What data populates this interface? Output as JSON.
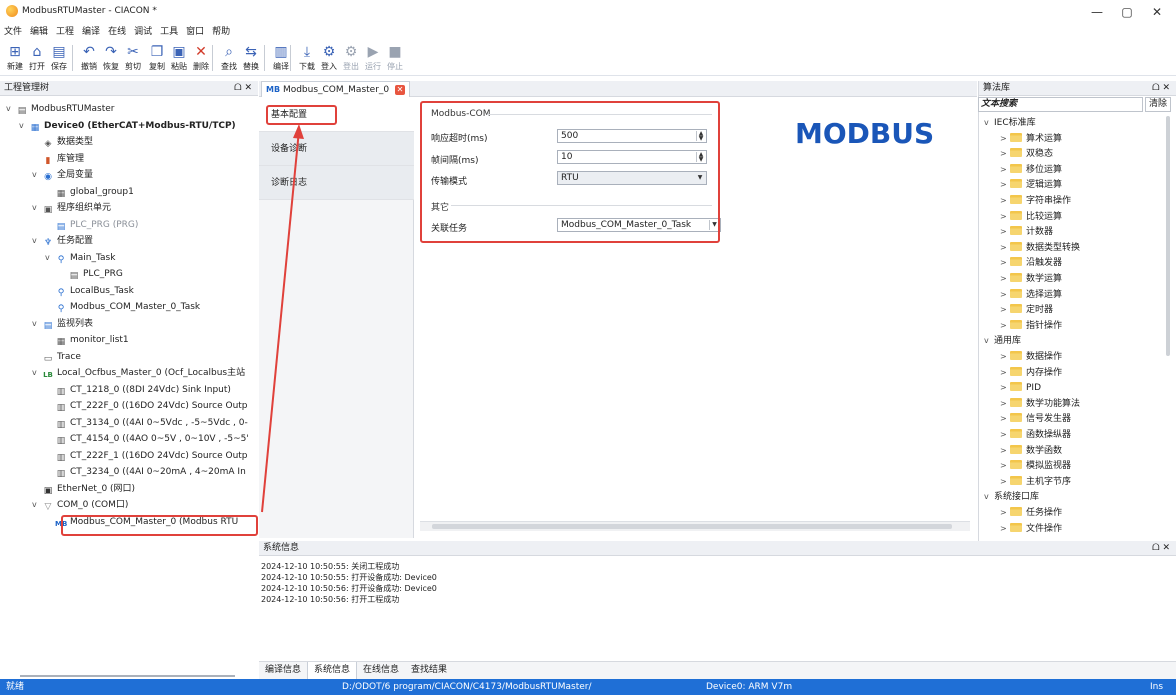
{
  "window": {
    "title": "ModbusRTUMaster - CIACON *",
    "minimize": "—",
    "maximize": "▢",
    "close": "✕"
  },
  "menu": [
    "文件",
    "编辑",
    "工程",
    "编译",
    "在线",
    "调试",
    "工具",
    "窗口",
    "帮助"
  ],
  "toolbar": [
    {
      "label": "新建",
      "icon": "new-icon",
      "glyph": "⊞",
      "enabled": true
    },
    {
      "label": "打开",
      "icon": "open-icon",
      "glyph": "⌂",
      "enabled": true
    },
    {
      "label": "保存",
      "icon": "save-icon",
      "glyph": "▤",
      "enabled": true
    },
    {
      "label": "撤销",
      "icon": "undo-icon",
      "glyph": "↶",
      "enabled": true
    },
    {
      "label": "恢复",
      "icon": "redo-icon",
      "glyph": "↷",
      "enabled": true
    },
    {
      "label": "剪切",
      "icon": "cut-icon",
      "glyph": "✂",
      "enabled": true
    },
    {
      "label": "复制",
      "icon": "copy-icon",
      "glyph": "❐",
      "enabled": true
    },
    {
      "label": "粘贴",
      "icon": "paste-icon",
      "glyph": "▣",
      "enabled": true
    },
    {
      "label": "删除",
      "icon": "delete-icon",
      "glyph": "✕",
      "enabled": true
    },
    {
      "label": "查找",
      "icon": "find-icon",
      "glyph": "⌕",
      "enabled": true
    },
    {
      "label": "替换",
      "icon": "replace-icon",
      "glyph": "⇆",
      "enabled": true
    },
    {
      "label": "编译",
      "icon": "compile-icon",
      "glyph": "▥",
      "enabled": true
    },
    {
      "label": "下载",
      "icon": "download-icon",
      "glyph": "⤓",
      "enabled": true
    },
    {
      "label": "登入",
      "icon": "login-icon",
      "glyph": "⚙",
      "enabled": true
    },
    {
      "label": "登出",
      "icon": "logout-icon",
      "glyph": "⚙",
      "enabled": false
    },
    {
      "label": "运行",
      "icon": "run-icon",
      "glyph": "▶",
      "enabled": false
    },
    {
      "label": "停止",
      "icon": "stop-icon",
      "glyph": "■",
      "enabled": false
    }
  ],
  "project_tree": {
    "title": "工程管理树",
    "pin": "ᗝ ✕",
    "items": [
      {
        "label": "ModbusRTUMaster",
        "level": 0,
        "arrow": "v",
        "icon": "project-icon",
        "glyph": "▤",
        "color": "#555"
      },
      {
        "label": "Device0 (EtherCAT+Modbus-RTU/TCP)",
        "level": 1,
        "arrow": "v",
        "icon": "device-icon",
        "glyph": "▦",
        "color": "#2a6fd0",
        "bold": true
      },
      {
        "label": "数据类型",
        "level": 2,
        "arrow": "",
        "icon": "datatype-icon",
        "glyph": "◈",
        "color": "#555"
      },
      {
        "label": "库管理",
        "level": 2,
        "arrow": "",
        "icon": "library-icon",
        "glyph": "▮",
        "color": "#d0562a"
      },
      {
        "label": "全局变量",
        "level": 2,
        "arrow": "v",
        "icon": "globe-icon",
        "glyph": "◉",
        "color": "#2a6fd0"
      },
      {
        "label": "global_group1",
        "level": 3,
        "arrow": "",
        "icon": "table-icon",
        "glyph": "▦",
        "color": "#555"
      },
      {
        "label": "程序组织单元",
        "level": 2,
        "arrow": "v",
        "icon": "pou-icon",
        "glyph": "▣",
        "color": "#555"
      },
      {
        "label": "PLC_PRG (PRG)",
        "level": 3,
        "arrow": "",
        "icon": "program-icon",
        "glyph": "▤",
        "color": "#2a6fd0",
        "grey": true
      },
      {
        "label": "任务配置",
        "level": 2,
        "arrow": "v",
        "icon": "task-config-icon",
        "glyph": "♆",
        "color": "#2a6fd0"
      },
      {
        "label": "Main_Task",
        "level": 3,
        "arrow": "v",
        "icon": "task-icon",
        "glyph": "⚲",
        "color": "#2a6fd0"
      },
      {
        "label": "PLC_PRG",
        "level": 4,
        "arrow": "",
        "icon": "program-icon",
        "glyph": "▤",
        "color": "#555"
      },
      {
        "label": "LocalBus_Task",
        "level": 3,
        "arrow": "",
        "icon": "task-icon",
        "glyph": "⚲",
        "color": "#2a6fd0"
      },
      {
        "label": "Modbus_COM_Master_0_Task",
        "level": 3,
        "arrow": "",
        "icon": "task-icon",
        "glyph": "⚲",
        "color": "#2a6fd0"
      },
      {
        "label": "监视列表",
        "level": 2,
        "arrow": "v",
        "icon": "watch-icon",
        "glyph": "▤",
        "color": "#2a6fd0"
      },
      {
        "label": "monitor_list1",
        "level": 3,
        "arrow": "",
        "icon": "table-icon",
        "glyph": "▦",
        "color": "#555"
      },
      {
        "label": "Trace",
        "level": 2,
        "arrow": "",
        "icon": "trace-icon",
        "glyph": "▭",
        "color": "#555"
      },
      {
        "label": "Local_Ocfbus_Master_0 (Ocf_Localbus主站",
        "level": 2,
        "arrow": "v",
        "icon": "localbus-icon",
        "glyph": "LB",
        "color": "#2a8a3a"
      },
      {
        "label": "CT_1218_0 ((8DI 24Vdc) Sink Input)",
        "level": 3,
        "arrow": "",
        "icon": "module-icon",
        "glyph": "▥",
        "color": "#555"
      },
      {
        "label": "CT_222F_0 ((16DO 24Vdc) Source Outp",
        "level": 3,
        "arrow": "",
        "icon": "module-icon",
        "glyph": "▥",
        "color": "#555"
      },
      {
        "label": "CT_3134_0 ((4AI 0~5Vdc , -5~5Vdc , 0-",
        "level": 3,
        "arrow": "",
        "icon": "module-icon",
        "glyph": "▥",
        "color": "#555"
      },
      {
        "label": "CT_4154_0 ((4AO 0~5V , 0~10V , -5~5'",
        "level": 3,
        "arrow": "",
        "icon": "module-icon",
        "glyph": "▥",
        "color": "#555"
      },
      {
        "label": "CT_222F_1 ((16DO 24Vdc) Source Outp",
        "level": 3,
        "arrow": "",
        "icon": "module-icon",
        "glyph": "▥",
        "color": "#555"
      },
      {
        "label": "CT_3234_0 ((4AI 0~20mA , 4~20mA In",
        "level": 3,
        "arrow": "",
        "icon": "module-icon",
        "glyph": "▥",
        "color": "#555"
      },
      {
        "label": "EtherNet_0 (网口)",
        "level": 2,
        "arrow": "",
        "icon": "ethernet-icon",
        "glyph": "▣",
        "color": "#333"
      },
      {
        "label": "COM_0 (COM口)",
        "level": 2,
        "arrow": "v",
        "icon": "com-icon",
        "glyph": "▽",
        "color": "#888"
      },
      {
        "label": "Modbus_COM_Master_0 (Modbus RTU",
        "level": 3,
        "arrow": "",
        "icon": "modbus-icon",
        "glyph": "MB",
        "color": "#1c63c7",
        "selected": true
      }
    ]
  },
  "editor_tab": {
    "icon_text": "MB",
    "label": "Modbus_COM_Master_0",
    "close": "✕"
  },
  "side_tabs": [
    "基本配置",
    "设备诊断",
    "诊断日志"
  ],
  "config": {
    "group1_title": "Modbus-COM",
    "response_timeout_label": "响应超时(ms)",
    "response_timeout_value": "500",
    "frame_interval_label": "帧间隔(ms)",
    "frame_interval_value": "10",
    "transfer_mode_label": "传输模式",
    "transfer_mode_value": "RTU",
    "group2_title": "其它",
    "assoc_task_label": "关联任务",
    "assoc_task_value": "Modbus_COM_Master_0_Task"
  },
  "logo_text": "MODBUS",
  "system_info": {
    "title": "系统信息",
    "pin": "ᗝ ✕",
    "lines": [
      "2024-12-10 10:50:55: 关闭工程成功",
      "2024-12-10 10:50:55: 打开设备成功: Device0",
      "2024-12-10 10:50:56: 打开设备成功: Device0",
      "2024-12-10 10:50:56: 打开工程成功"
    ]
  },
  "bottom_tabs": [
    "编译信息",
    "系统信息",
    "在线信息",
    "查找结果"
  ],
  "library": {
    "title": "算法库",
    "pin": "ᗝ ✕",
    "search_placeholder": "文本搜索",
    "clear_label": "清除",
    "items": [
      {
        "label": "IEC标准库",
        "group": true,
        "arrow": "v"
      },
      {
        "label": "算术运算",
        "arrow": ">"
      },
      {
        "label": "双稳态",
        "arrow": ">"
      },
      {
        "label": "移位运算",
        "arrow": ">"
      },
      {
        "label": "逻辑运算",
        "arrow": ">"
      },
      {
        "label": "字符串操作",
        "arrow": ">"
      },
      {
        "label": "比较运算",
        "arrow": ">"
      },
      {
        "label": "计数器",
        "arrow": ">"
      },
      {
        "label": "数据类型转换",
        "arrow": ">"
      },
      {
        "label": "沿触发器",
        "arrow": ">"
      },
      {
        "label": "数学运算",
        "arrow": ">"
      },
      {
        "label": "选择运算",
        "arrow": ">"
      },
      {
        "label": "定时器",
        "arrow": ">"
      },
      {
        "label": "指针操作",
        "arrow": ">"
      },
      {
        "label": "通用库",
        "group": true,
        "arrow": "v"
      },
      {
        "label": "数据操作",
        "arrow": ">"
      },
      {
        "label": "内存操作",
        "arrow": ">"
      },
      {
        "label": "PID",
        "arrow": ">"
      },
      {
        "label": "数学功能算法",
        "arrow": ">"
      },
      {
        "label": "信号发生器",
        "arrow": ">"
      },
      {
        "label": "函数操纵器",
        "arrow": ">"
      },
      {
        "label": "数学函数",
        "arrow": ">"
      },
      {
        "label": "模拟监视器",
        "arrow": ">"
      },
      {
        "label": "主机字节序",
        "arrow": ">"
      },
      {
        "label": "系统接口库",
        "group": true,
        "arrow": "v"
      },
      {
        "label": "任务操作",
        "arrow": ">"
      },
      {
        "label": "文件操作",
        "arrow": ">"
      }
    ]
  },
  "status": {
    "left": "就绪",
    "path": "D:/ODOT/6 program/CIACON/C4173/ModbusRTUMaster/",
    "device": "Device0: ARM V7m",
    "mode": "Ins"
  },
  "colors": {
    "accent": "#1f6fd6",
    "highlight": "#e0413b",
    "logo": "#1a56b8"
  }
}
